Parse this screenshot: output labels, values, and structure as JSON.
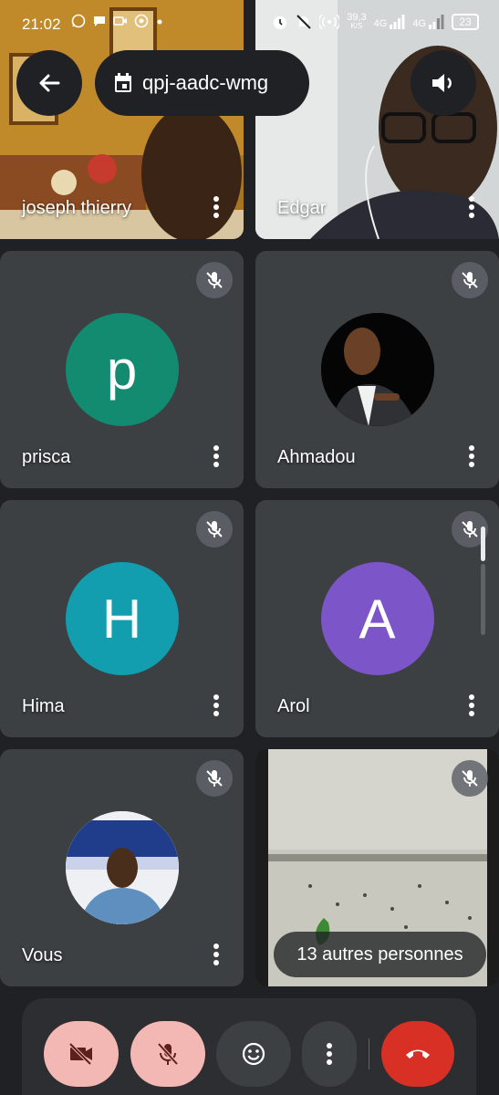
{
  "status_bar": {
    "time": "21:02",
    "speed_value": "39,3",
    "speed_unit": "K/S",
    "net1": "4G",
    "net2": "4G",
    "battery": "23"
  },
  "meeting": {
    "code": "qpj-aadc-wmg"
  },
  "participants": [
    {
      "name": "joseph thierry",
      "type": "video"
    },
    {
      "name": "Edgar",
      "type": "video"
    },
    {
      "name": "prisca",
      "initial": "p",
      "color": "#138b70"
    },
    {
      "name": "Ahmadou",
      "type": "photo"
    },
    {
      "name": "Hima",
      "initial": "H",
      "color": "#129eaf"
    },
    {
      "name": "Arol",
      "initial": "A",
      "color": "#7c55c9"
    },
    {
      "name": "Vous",
      "type": "photo"
    },
    {
      "name": "",
      "type": "video"
    }
  ],
  "others_label": "13 autres personnes",
  "colors": {
    "background": "#202124",
    "tile": "#3c4043",
    "control_red_light": "#f4b8b4",
    "hangup": "#d93025"
  },
  "controls": {
    "camera": "camera-off-icon",
    "mic": "mic-off-icon",
    "reactions": "emoji-icon",
    "more": "more-vert-icon",
    "hangup": "call-end-icon"
  }
}
